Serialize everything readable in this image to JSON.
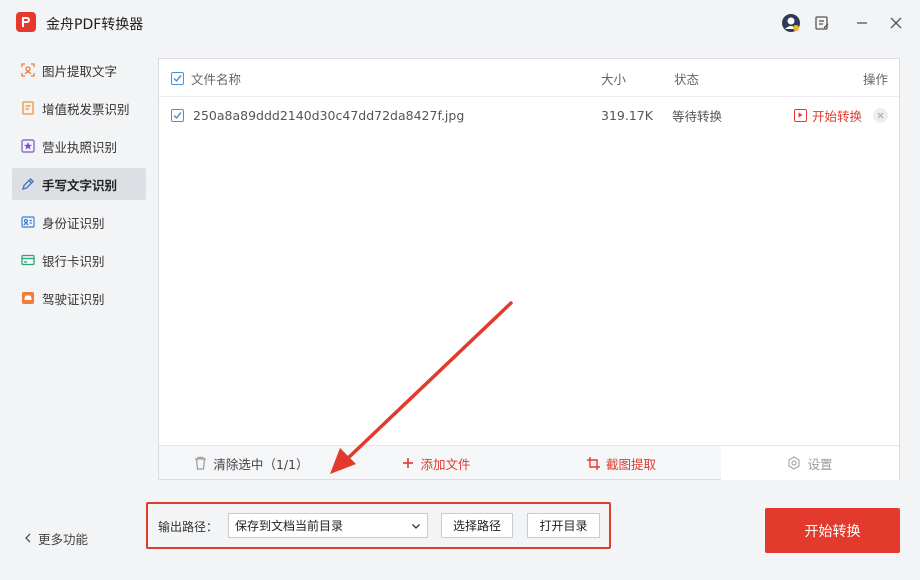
{
  "app": {
    "title": "金舟PDF转换器"
  },
  "sidebar": {
    "items": [
      {
        "label": "图片提取文字",
        "icon": "image-text-icon",
        "color": "#f07b3b"
      },
      {
        "label": "增值税发票识别",
        "icon": "invoice-icon",
        "color": "#f0913b"
      },
      {
        "label": "营业执照识别",
        "icon": "license-star-icon",
        "color": "#7a55c9"
      },
      {
        "label": "手写文字识别",
        "icon": "pen-icon",
        "color": "#4b73c6"
      },
      {
        "label": "身份证识别",
        "icon": "id-card-icon",
        "color": "#3b7fd8"
      },
      {
        "label": "银行卡识别",
        "icon": "bank-card-icon",
        "color": "#2aa876"
      },
      {
        "label": "驾驶证识别",
        "icon": "car-icon",
        "color": "#f07b3b"
      }
    ],
    "active_index": 3,
    "more_label": "更多功能"
  },
  "table": {
    "headers": {
      "name": "文件名称",
      "size": "大小",
      "status": "状态",
      "action": "操作"
    },
    "rows": [
      {
        "name": "250a8a89ddd2140d30c47dd72da8427f.jpg",
        "size": "319.17K",
        "status": "等待转换",
        "action": "开始转换"
      }
    ]
  },
  "toolbar": {
    "clear_label": "清除选中",
    "clear_count": "（1/1）",
    "add_label": "添加文件",
    "crop_label": "截图提取",
    "settings_label": "设置"
  },
  "output": {
    "label": "输出路径：",
    "selected": "保存到文档当前目录",
    "choose_label": "选择路径",
    "open_label": "打开目录"
  },
  "start_button": "开始转换",
  "colors": {
    "accent": "#e23a2c",
    "checkbox": "#4a8fd8"
  }
}
